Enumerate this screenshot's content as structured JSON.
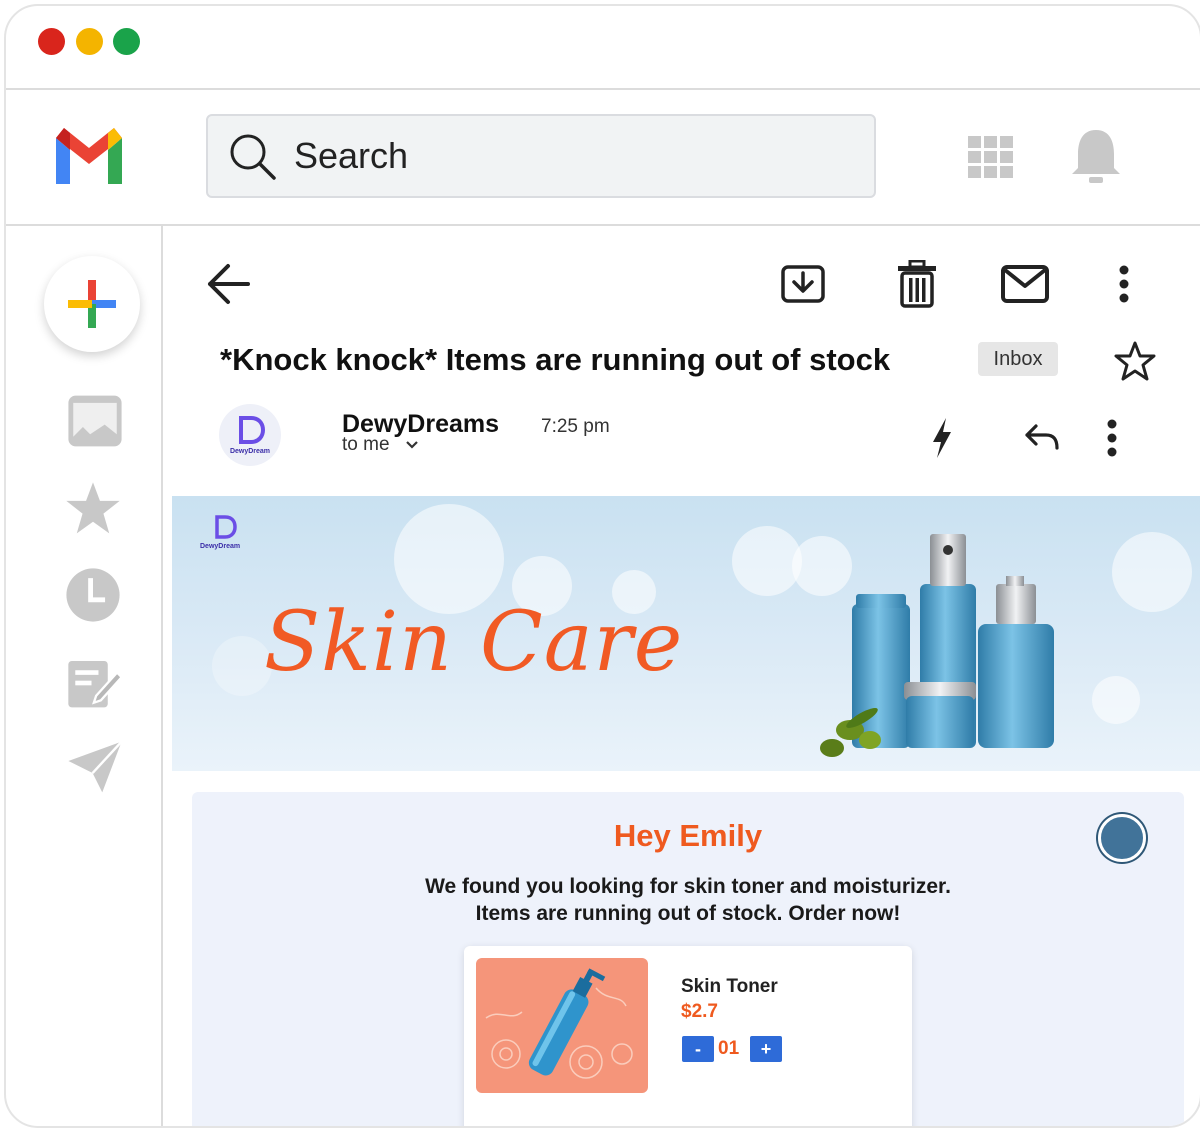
{
  "window": {
    "dot_colors": [
      "#d9251c",
      "#f4b400",
      "#1aa34a"
    ]
  },
  "header": {
    "logo_icon": "gmail-logo-icon",
    "search": {
      "placeholder": "Search"
    },
    "apps_icon": "apps-grid-icon",
    "notifications_icon": "bell-icon"
  },
  "sidebar": {
    "items": [
      {
        "icon": "compose-plus-icon"
      },
      {
        "icon": "inbox-icon"
      },
      {
        "icon": "star-icon"
      },
      {
        "icon": "clock-icon"
      },
      {
        "icon": "drafts-icon"
      },
      {
        "icon": "send-icon"
      }
    ]
  },
  "toolbar": {
    "icons": [
      "back-arrow-icon",
      "archive-icon",
      "trash-icon",
      "mail-icon",
      "more-vert-icon"
    ]
  },
  "email": {
    "subject": "*Knock knock* Items are running out of stock",
    "label": "Inbox",
    "sender": "DewyDreams",
    "recipient": "to me",
    "time": "7:25 pm",
    "avatar_text": "DewyDream",
    "brand_initial": "D"
  },
  "banner": {
    "headline": "Skin Care",
    "logo_text": "DewyDream",
    "logo_initial": "D"
  },
  "content": {
    "greeting": "Hey Emily",
    "message_line1": "We found you looking for skin toner and moisturizer.",
    "message_line2": "Items are running out of stock. Order now!",
    "product": {
      "name": "Skin Toner",
      "price": "$2.7",
      "quantity": "01",
      "minus": "-",
      "plus": "+"
    }
  },
  "colors": {
    "accent_orange": "#ef5a1f",
    "button_blue": "#2e6bd8",
    "radio_blue": "#417399"
  }
}
